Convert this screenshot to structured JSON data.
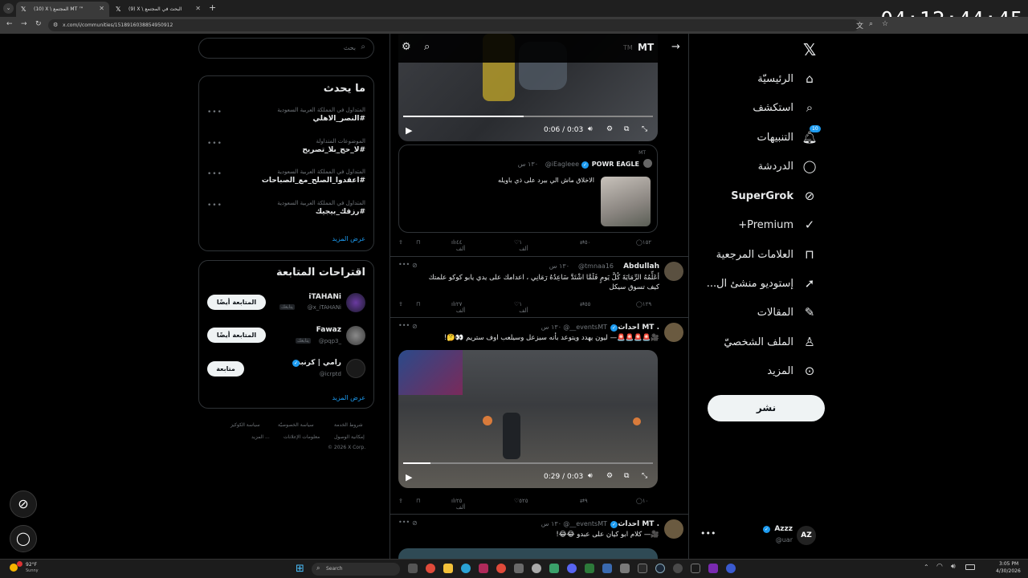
{
  "browser": {
    "tabs": [
      {
        "label": "(10) X \\ المجتمع MT ™"
      },
      {
        "label": "(9) X \\ البحث في المجتمع"
      }
    ],
    "new_tab": "+",
    "url": "x.com/i/communities/1518916038854950912",
    "clock": "04:12:44:45"
  },
  "nav": {
    "items": [
      {
        "label": "الرئيسيّة",
        "icon": "home-icon"
      },
      {
        "label": "استكشف",
        "icon": "search-icon"
      },
      {
        "label": "التنبيهات",
        "icon": "bell-icon",
        "badge": "10"
      },
      {
        "label": "الدردشة",
        "icon": "chat-icon"
      },
      {
        "label": "SuperGrok",
        "icon": "grok-icon"
      },
      {
        "label": "Premium+",
        "icon": "premium-icon"
      },
      {
        "label": "العلامات المرجعية",
        "icon": "bookmark-icon"
      },
      {
        "label": "إستوديو منشئ ال...",
        "icon": "rocket-icon"
      },
      {
        "label": "المقالات",
        "icon": "article-icon"
      },
      {
        "label": "الملف الشخصيّ",
        "icon": "profile-icon"
      },
      {
        "label": "المزيد",
        "icon": "more-icon"
      }
    ],
    "post_label": "نشر",
    "account": {
      "name": "Azzz",
      "handle": "@uar"
    }
  },
  "feed": {
    "header": {
      "title": "MT",
      "tm": "TM"
    },
    "video1": {
      "time": "0:06 / 0:03"
    },
    "quote": {
      "community": "MT",
      "name": "POWR EAGLE",
      "handle": "@iEagleee",
      "time": "١٣٠ س",
      "text": "الاخلاق ماش الي بيرد على ذي باويله"
    },
    "actions1": {
      "replies": "١٥٢",
      "reposts": "٥٠",
      "likes": "١ ألف",
      "views": "٤٤ ألف"
    },
    "tweet2": {
      "name": "Abdullah",
      "handle": "@tmnaa16",
      "time": "١٣٠ س",
      "line1": "أعَلِّمُهُ الرِّمَايَةَ كُلَّ يَومٍ فَلَمَّا اشْتَدَّ سَاعِدُهُ رَمَانِي ، اعدامك على يدي يابو كوكو علمتك",
      "line2": "كيف تسوق سيكل"
    },
    "actions2": {
      "replies": "١٢٩",
      "reposts": "٥٥",
      "likes": "١ ألف",
      "views": "٢٧ ألف"
    },
    "tweet3": {
      "name": "احداث MT .",
      "handle": "@__eventsMT",
      "time": "١٣٠ س",
      "text": "🎥🚨🚨🚨🚨— ليون يهدد ويتوعد بأنه سيزعل وسيلعب اوف ستريم 👀🤔!"
    },
    "video2": {
      "time": "0:29 / 0:03"
    },
    "actions3": {
      "replies": "١٠",
      "reposts": "٩",
      "likes": "٥٢٥",
      "views": "٢٥ ألف"
    },
    "tweet4": {
      "name": "احداث MT .",
      "handle": "@__eventsMT",
      "time": "١٣٠ س",
      "text": "🎥— كلام ابو كيان على عبدو 😂😂!"
    }
  },
  "right": {
    "search_placeholder": "بحث",
    "trends_title": "ما يحدث",
    "trends": [
      {
        "context": "المتداول في المملكة العربية السعودية",
        "tag": "#النصر_الاهلي"
      },
      {
        "context": "الموضوعات المتداولة",
        "tag": "#لا_حج_بلا_تصريح"
      },
      {
        "context": "المتداول في المملكة العربية السعودية",
        "tag": "#اعقدوا_الصلح_مع_الصباحات"
      },
      {
        "context": "المتداول في المملكة العربية السعودية",
        "tag": "#رزقك_بيجيك"
      }
    ],
    "show_more": "عرض المزيد",
    "who_title": "اقتراحات المتابعة",
    "suggestions": [
      {
        "name": "iTAHANi",
        "handle": "@x_iTAHANi",
        "follows_you": "يتابعك",
        "button": "المتابعة أيضًا"
      },
      {
        "name": "Fawaz",
        "handle": "@pqp3_",
        "follows_you": "يتابعك",
        "button": "المتابعة أيضًا"
      },
      {
        "name": "رامي | كرنبد",
        "handle": "@icrptd",
        "button": "متابعة"
      }
    ],
    "show_more2": "عرض المزيد",
    "footer": {
      "row1": [
        "شروط الخدمة",
        "سياسة الخصوصيّة",
        "سياسة الكوكيز"
      ],
      "row2": [
        "إمكانية الوصول",
        "معلومات الإعلانات",
        "المزيد ..."
      ],
      "row3": "© 2026 X Corp."
    }
  },
  "taskbar": {
    "weather_temp": "92°F",
    "weather_desc": "Sunny",
    "search": "Search",
    "time": "3:05 PM",
    "date": "4/30/2026"
  },
  "colors": {
    "accent": "#1d9bf0",
    "bg": "#000000",
    "border": "#2f3336"
  }
}
